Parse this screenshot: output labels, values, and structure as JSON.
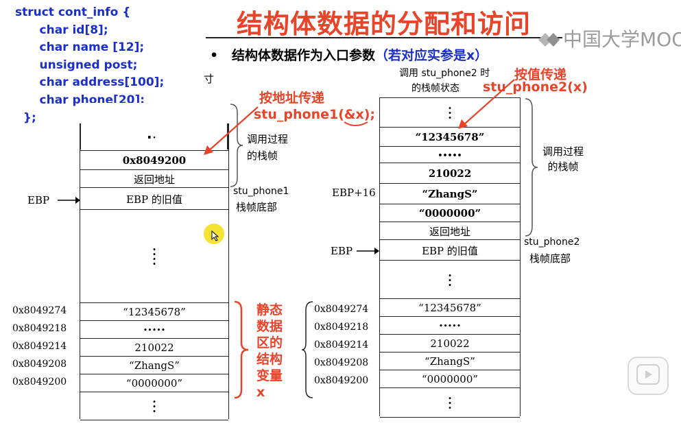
{
  "code": {
    "lines": [
      "struct cont_info {",
      "      char id[8];",
      "      char name [12];",
      "      unsigned post;",
      "      char address[100];",
      "      char phone[20];",
      "  };"
    ]
  },
  "title": "结构体数据的分配和访问",
  "logo_text": "中国大学MOOC",
  "bullet": {
    "main": "结构体数据作为入口参数",
    "paren": "（若对应实参是x）"
  },
  "left": {
    "arrow_label_1": "按地址传递",
    "arrow_label_2": "stu_phone1(&x);",
    "partial_char": "寸",
    "rows": {
      "top_dot": "·",
      "addr_val": "0x8049200",
      "ret": "返回地址",
      "ebp_old": "EBP 的旧值",
      "s1": "“12345678”",
      "s2": "•••••",
      "s3": "210022",
      "s4": "“ZhangS”",
      "s5": "“0000000”"
    },
    "ebp_label": "EBP",
    "brace_label": "调用过程\n的栈帧",
    "frame_bottom_1": "stu_phone1",
    "frame_bottom_2": "栈帧底部",
    "addresses": [
      "0x8049274",
      "0x8049218",
      "0x8049214",
      "0x8049208",
      "0x8049200"
    ],
    "static_label": "静态\n数据\n区的\n结构\n变量\nx"
  },
  "right": {
    "state_1": "调用 stu_phone2 时",
    "state_2": "的栈帧状态",
    "arrow_label_1": "按值传递",
    "arrow_label_2": "stu_phone2(x)",
    "rows": {
      "r1": "“12345678”",
      "r2": "•••••",
      "r3": "210022",
      "r4": "“ZhangS”",
      "r5": "“0000000”",
      "ret": "返回地址",
      "ebp_old": "EBP 的旧值",
      "s1": "“12345678”",
      "s2": "•••••",
      "s3": "210022",
      "s4": "“ZhangS”",
      "s5": "“0000000”"
    },
    "ebp16": "EBP+16",
    "ebp_label": "EBP",
    "brace_label": "调用过程\n的栈帧",
    "frame_bottom_1": "stu_phone2",
    "frame_bottom_2": "栈帧底部",
    "addresses": [
      "0x8049274",
      "0x8049218",
      "0x8049214",
      "0x8049208",
      "0x8049200"
    ]
  },
  "colors": {
    "code_blue": "#1a2fc9",
    "title_red": "#e8442a",
    "arrow_red": "#e8442a"
  }
}
